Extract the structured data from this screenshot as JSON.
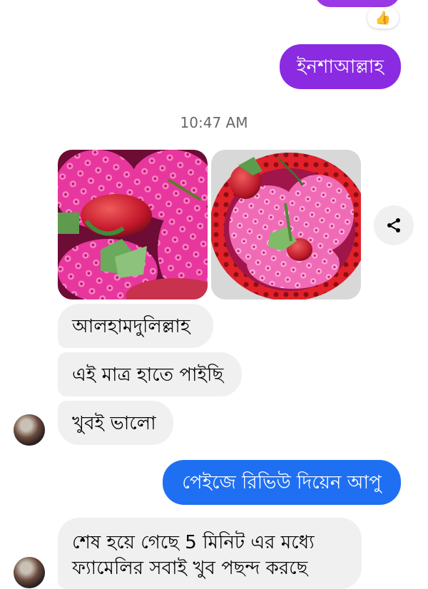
{
  "messages": {
    "outgoing_1": "ইনশাআল্লাহ",
    "timestamp": "10:47 AM",
    "incoming_1": "আলহামদুলিল্লাহ",
    "incoming_2": "এই মাত্র হাতে পাইছি",
    "incoming_3": "খুবই ভালো",
    "outgoing_2": "পেইজে রিভিউ দিয়েন আপু",
    "incoming_4_line1": "শেষ হয়ে গেছে 5 মিনিট এর মধ্যে",
    "incoming_4_line2": "ফ্যামেলির সবাই  খুব পছন্দ করছে"
  },
  "reaction": {
    "icon": "thumbs-up-icon",
    "emoji": "👍"
  },
  "share": {
    "icon": "share-icon"
  },
  "colors": {
    "purple": "#8a2be2",
    "blue": "#1f6ff2",
    "incoming": "#f0f0f0"
  }
}
